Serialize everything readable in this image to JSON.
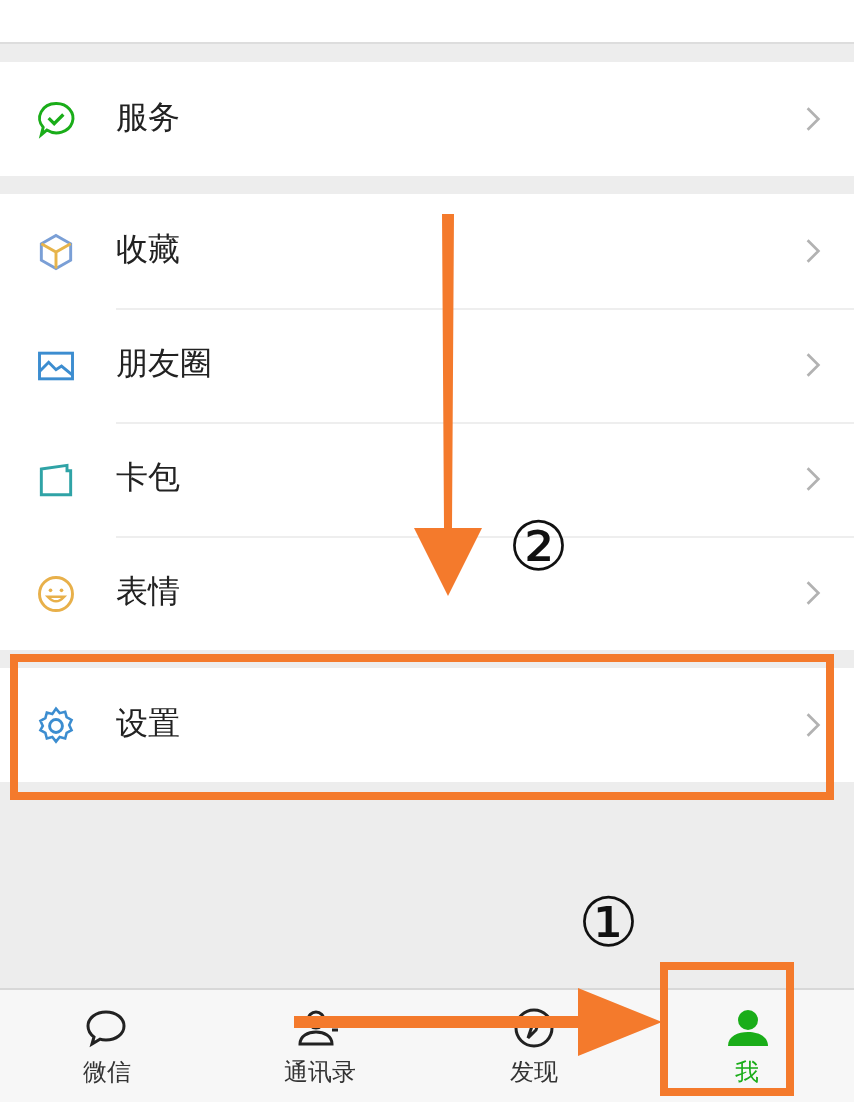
{
  "groups": [
    {
      "rows": [
        {
          "label": "服务",
          "marked": false
        }
      ]
    },
    {
      "rows": [
        {
          "label": "收藏",
          "marked": false
        },
        {
          "label": "朋友圈",
          "marked": false
        },
        {
          "label": "卡包",
          "marked": false
        },
        {
          "label": "表情",
          "marked": false
        }
      ]
    },
    {
      "rows": [
        {
          "label": "设置",
          "marked": true
        }
      ]
    }
  ],
  "tabs": [
    {
      "label": "微信",
      "selected": false,
      "marked": false
    },
    {
      "label": "通讯录",
      "selected": false,
      "marked": false
    },
    {
      "label": "发现",
      "selected": false,
      "marked": false
    },
    {
      "label": "我",
      "selected": true,
      "marked": true
    }
  ],
  "annotations": [
    {
      "label": "②"
    },
    {
      "label": "①"
    }
  ]
}
